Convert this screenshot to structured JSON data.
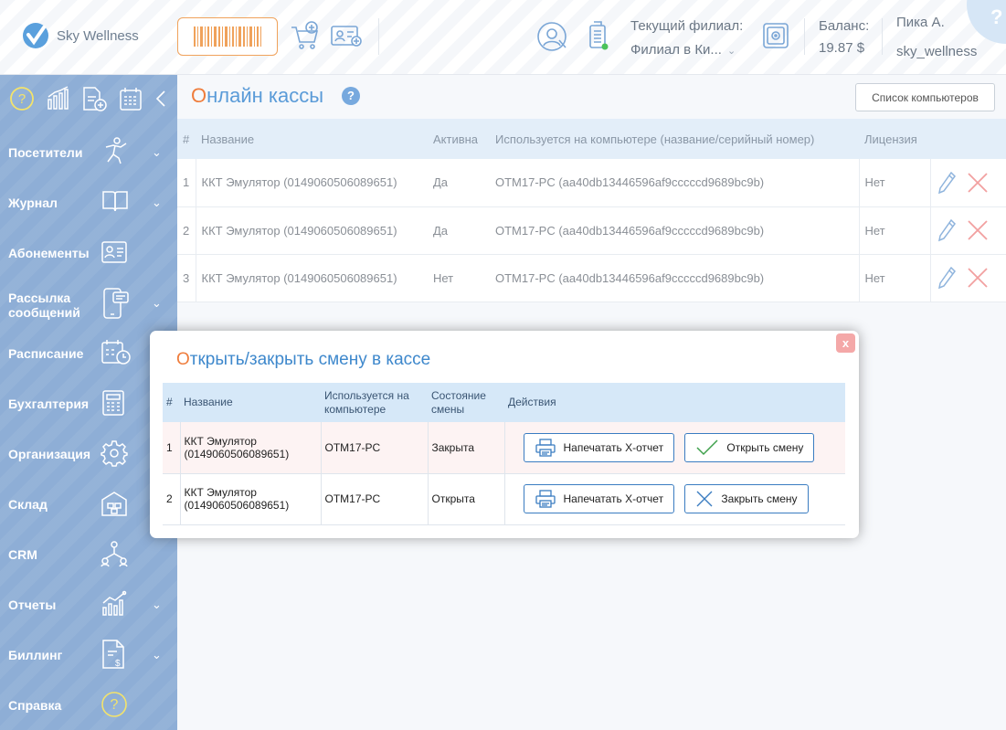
{
  "header": {
    "logo_text": "Sky Wellness",
    "branch_label": "Текущий филиал:",
    "branch_value": "Филиал в Ки...",
    "balance_label": "Баланс:",
    "balance_value": "19.87 $",
    "user_name": "Пика А.",
    "user_login": "sky_wellness",
    "help_glyph": "?"
  },
  "sidebar": {
    "items": [
      {
        "label": "Посетители",
        "icon": "visitors-icon",
        "chevron": true
      },
      {
        "label": "Журнал",
        "icon": "book-icon",
        "chevron": true
      },
      {
        "label": "Абонементы",
        "icon": "subscription-card-icon",
        "chevron": false
      },
      {
        "label": "Рассылка сообщений",
        "icon": "messaging-icon",
        "chevron": true
      },
      {
        "label": "Расписание",
        "icon": "calendar-clock-icon",
        "chevron": false
      },
      {
        "label": "Бухгалтерия",
        "icon": "calculator-icon",
        "chevron": false
      },
      {
        "label": "Организация",
        "icon": "gear-icon",
        "chevron": false
      },
      {
        "label": "Склад",
        "icon": "warehouse-icon",
        "chevron": false
      },
      {
        "label": "CRM",
        "icon": "crm-network-icon",
        "chevron": false
      },
      {
        "label": "Отчеты",
        "icon": "reports-chart-icon",
        "chevron": true
      },
      {
        "label": "Биллинг",
        "icon": "billing-doc-icon",
        "chevron": true
      },
      {
        "label": "Справка",
        "icon": "help-circle-icon",
        "chevron": false
      }
    ]
  },
  "page": {
    "title_first": "О",
    "title_rest": "нлайн кассы",
    "help_glyph": "?",
    "list_button": "Список компьютеров"
  },
  "kkt_table": {
    "headers": [
      "#",
      "Название",
      "Активна",
      "Используется на компьютере (название/серийный номер)",
      "Лицензия",
      ""
    ],
    "rows": [
      {
        "num": "1",
        "name": "ККТ Эмулятор (0149060506089651)",
        "active": "Да",
        "computer": "OTM17-PC (aa40db13446596af9cccccd9689bc9b)",
        "license": "Нет"
      },
      {
        "num": "2",
        "name": "ККТ Эмулятор (0149060506089651)",
        "active": "Да",
        "computer": "OTM17-PC (aa40db13446596af9cccccd9689bc9b)",
        "license": "Нет"
      },
      {
        "num": "3",
        "name": "ККТ Эмулятор (0149060506089651)",
        "active": "Нет",
        "computer": "OTM17-PC (aa40db13446596af9cccccd9689bc9b)",
        "license": "Нет"
      }
    ]
  },
  "modal": {
    "title_first": "О",
    "title_rest": "ткрыть/закрыть смену в кассе",
    "close_glyph": "x",
    "headers": [
      "#",
      "Название",
      "Используется на компьютере",
      "Состояние смены",
      "Действия"
    ],
    "rows": [
      {
        "num": "1",
        "name": "ККТ Эмулятор (0149060506089651)",
        "computer": "OTM17-PC",
        "state": "Закрыта",
        "print_label": "Напечатать X-отчет",
        "action_label": "Открыть смену"
      },
      {
        "num": "2",
        "name": "ККТ Эмулятор (0149060506089651)",
        "computer": "OTM17-PC",
        "state": "Открыта",
        "print_label": "Напечатать X-отчет",
        "action_label": "Закрыть смену"
      }
    ]
  },
  "colors": {
    "accent": "#5a9bd8",
    "title_first_letter": "#ef7d3c",
    "sidebar": "#8eaed6",
    "active_yes": "#7dbb7d",
    "active_no": "#e46d6d",
    "state_open": "#1e8a2e"
  }
}
